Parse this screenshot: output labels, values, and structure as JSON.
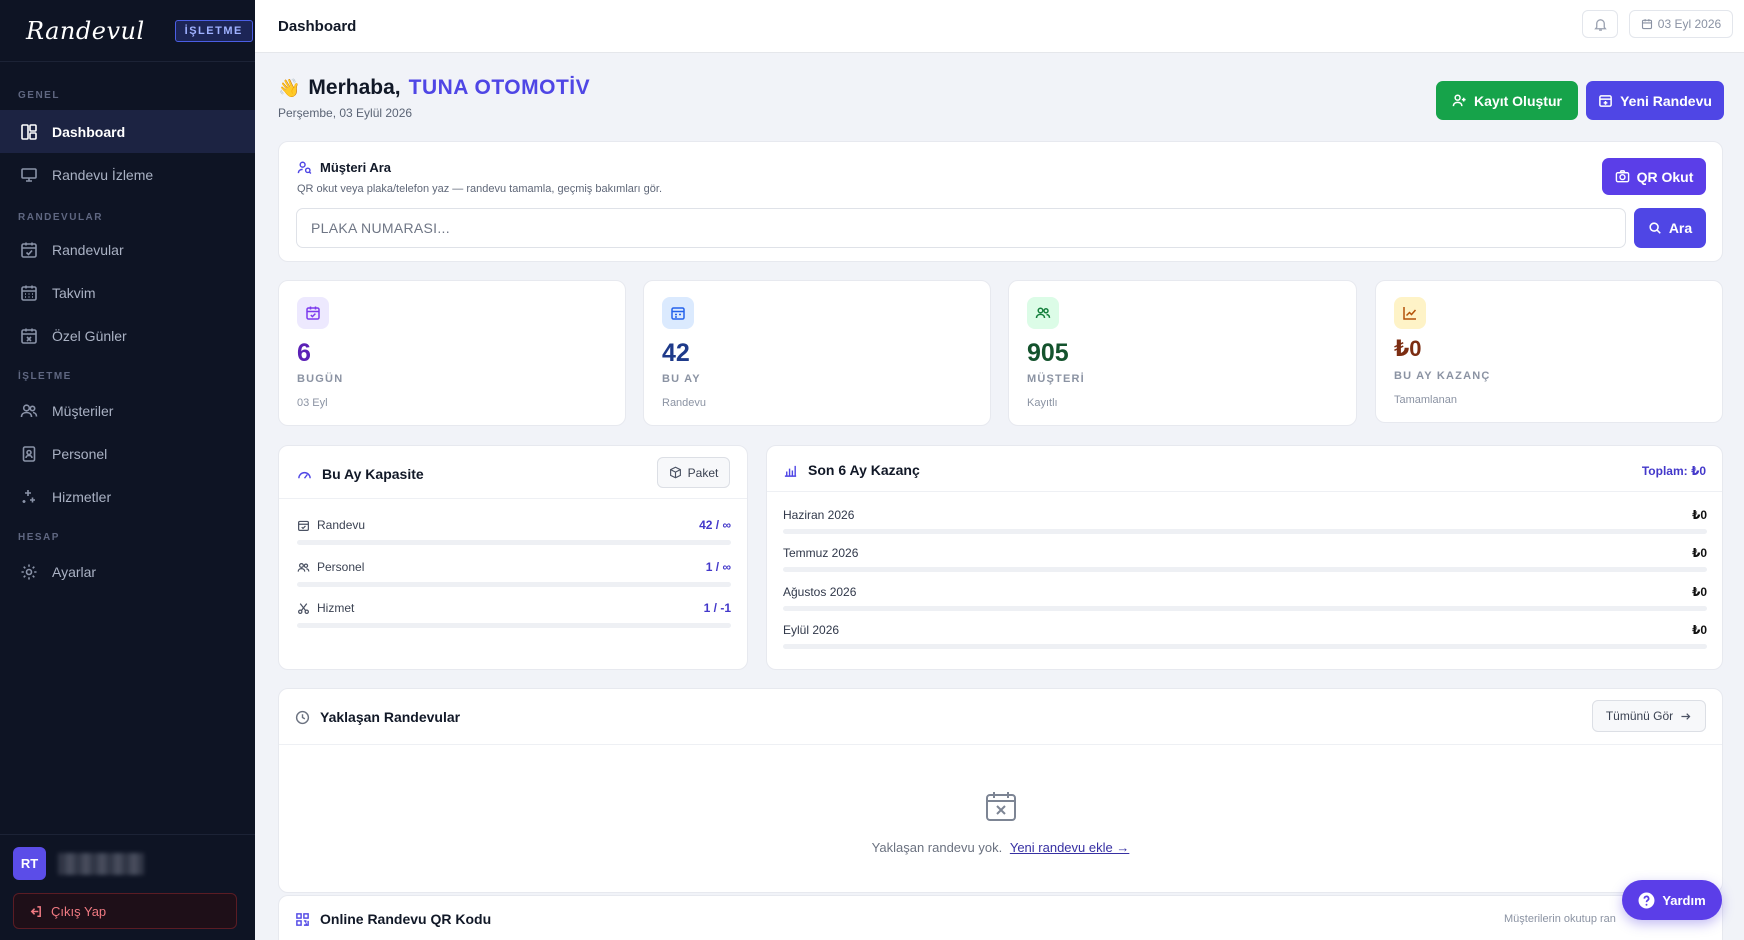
{
  "sidebar": {
    "logo": "Randevul",
    "badge": "İŞLETME",
    "sections": {
      "genel": "GENEL",
      "randevular": "RANDEVULAR",
      "isletme": "İŞLETME",
      "hesap": "HESAP"
    },
    "items": {
      "dashboard": "Dashboard",
      "randevu_izleme": "Randevu İzleme",
      "randevular": "Randevular",
      "takvim": "Takvim",
      "ozel_gunler": "Özel Günler",
      "musteriler": "Müşteriler",
      "personel": "Personel",
      "hizmetler": "Hizmetler",
      "ayarlar": "Ayarlar"
    },
    "user": {
      "initials": "RT"
    },
    "logout": "Çıkış Yap"
  },
  "topbar": {
    "title": "Dashboard",
    "date": "03 Eyl 2026"
  },
  "greeting": {
    "hello": "Merhaba,",
    "company": "TUNA OTOMOTİV",
    "date": "Perşembe, 03 Eylül 2026"
  },
  "actions": {
    "register": "Kayıt Oluştur",
    "new_appointment": "Yeni Randevu"
  },
  "customer_search": {
    "title": "Müşteri Ara",
    "subtitle": "QR okut veya plaka/telefon yaz — randevu tamamla, geçmiş bakımları gör.",
    "qr_button": "QR Okut",
    "placeholder": "PLAKA NUMARASI...",
    "search_button": "Ara"
  },
  "stats": [
    {
      "value": "6",
      "label": "BUGÜN",
      "sub": "03 Eyl",
      "color": "#5b21b6"
    },
    {
      "value": "42",
      "label": "BU AY",
      "sub": "Randevu",
      "color": "#1e3a8a"
    },
    {
      "value": "905",
      "label": "MÜŞTERİ",
      "sub": "Kayıtlı",
      "color": "#14532d"
    },
    {
      "value": "₺0",
      "label": "BU AY KAZANÇ",
      "sub": "Tamamlanan",
      "color": "#7c2d12"
    }
  ],
  "capacity": {
    "title": "Bu Ay Kapasite",
    "package_button": "Paket",
    "rows": [
      {
        "label": "Randevu",
        "value": "42 / ∞",
        "fill": 0
      },
      {
        "label": "Personel",
        "value": "1 / ∞",
        "fill": 0
      },
      {
        "label": "Hizmet",
        "value": "1 / -1",
        "fill": 0
      }
    ]
  },
  "earnings": {
    "title": "Son 6 Ay Kazanç",
    "total": "Toplam: ₺0",
    "rows": [
      {
        "month": "Haziran 2026",
        "value": "₺0"
      },
      {
        "month": "Temmuz 2026",
        "value": "₺0"
      },
      {
        "month": "Ağustos 2026",
        "value": "₺0"
      },
      {
        "month": "Eylül 2026",
        "value": "₺0"
      }
    ]
  },
  "upcoming": {
    "title": "Yaklaşan Randevular",
    "see_all": "Tümünü Gör",
    "empty_text": "Yaklaşan randevu yok.",
    "empty_link": "Yeni randevu ekle →"
  },
  "qr_section": {
    "title": "Online Randevu QR Kodu",
    "hint": "Müşterilerin okutup ran"
  },
  "help": "Yardım",
  "colors": {
    "accent": "#4f46e5",
    "success": "#16a34a",
    "sidebar": "#0e1424"
  }
}
